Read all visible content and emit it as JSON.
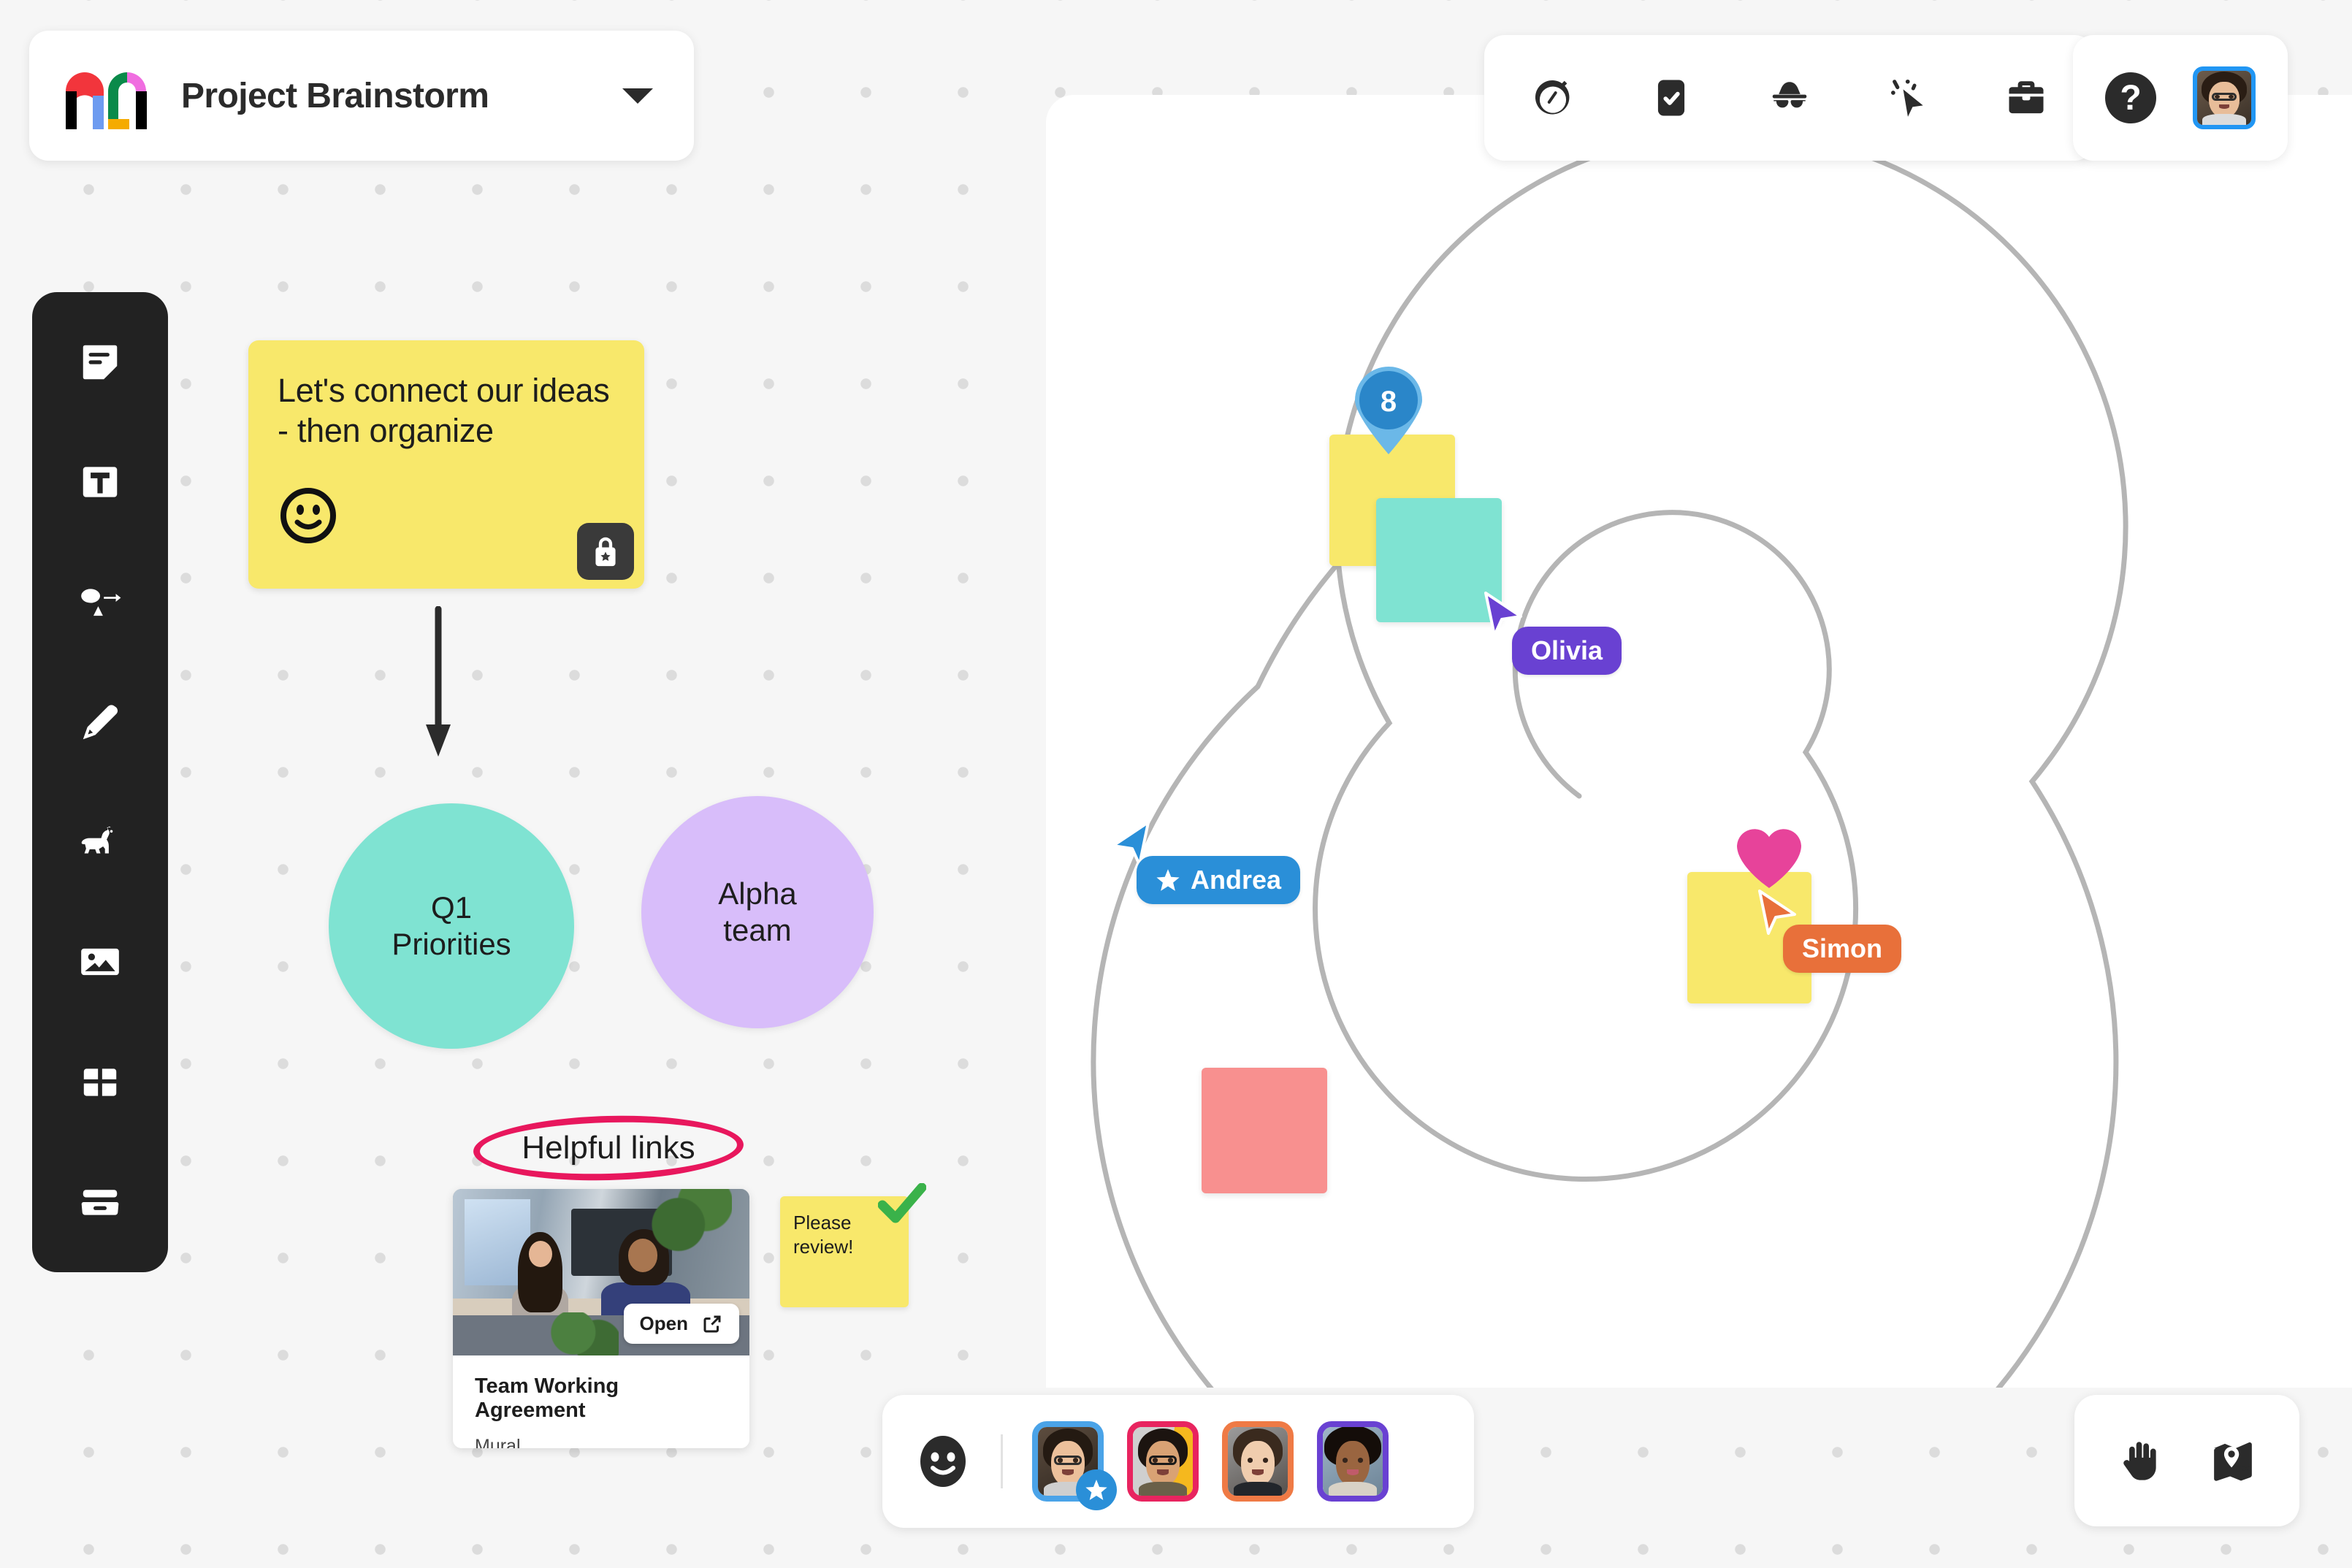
{
  "app": {
    "name": "Mural",
    "logo_icon": "mural-logo-icon"
  },
  "header": {
    "title": "Project Brainstorm",
    "dropdown_icon": "chevron-down-icon"
  },
  "left_toolbar": {
    "items": [
      {
        "icon": "sticky-note-icon",
        "label": "Sticky note"
      },
      {
        "icon": "text-icon",
        "label": "Text"
      },
      {
        "icon": "shapes-connector-icon",
        "label": "Shapes and connectors"
      },
      {
        "icon": "pen-icon",
        "label": "Drawing"
      },
      {
        "icon": "llama-icon",
        "label": "Mural llama"
      },
      {
        "icon": "image-icon",
        "label": "Image"
      },
      {
        "icon": "framework-grid-icon",
        "label": "Frameworks"
      },
      {
        "icon": "drawer-icon",
        "label": "Outline"
      }
    ]
  },
  "facilitation_toolbar": {
    "items": [
      {
        "icon": "timer-icon",
        "label": "Timer"
      },
      {
        "icon": "voting-checkbox-icon",
        "label": "Voting session"
      },
      {
        "icon": "private-mode-icon",
        "label": "Private mode"
      },
      {
        "icon": "summon-cursor-icon",
        "label": "Summon"
      },
      {
        "icon": "toolkit-icon",
        "label": "Facilitation toolkit"
      }
    ]
  },
  "help_bar": {
    "help_label": "?",
    "help_icon": "question-mark-icon",
    "avatar_icon": "current-user-avatar",
    "avatar_border_color": "#2196f3"
  },
  "canvas_left": {
    "sticky_main": {
      "text": "Let's connect our ideas - then organize",
      "emoji": "smiley-face-emoji",
      "color": "#f8e86b",
      "lock_badge_icon": "lock-star-icon"
    },
    "connector_icon": "down-arrow-connector",
    "shapes": [
      {
        "label": "Q1\nPriorities",
        "line1": "Q1",
        "line2": "Priorities",
        "color": "#7fe3d2"
      },
      {
        "label": "Alpha\nteam",
        "line1": "Alpha",
        "line2": "team",
        "color": "#d8bdfa"
      }
    ],
    "annotation": {
      "text": "Helpful links",
      "ink_color": "#e8175d",
      "shape": "ellipse"
    },
    "link_card": {
      "title": "Team Working Agreement",
      "source": "Mural",
      "open_label": "Open",
      "open_icon": "external-link-icon",
      "thumbnail_icon": "office-photo-thumbnail"
    },
    "sticky_review": {
      "text": "Please review!",
      "color": "#f8e86b",
      "check_icon": "green-check-icon",
      "check_color": "#3ab24a"
    }
  },
  "canvas_right": {
    "spiral_icon": "spiral-shape",
    "spiral_color": "#b5b5b5",
    "stickies": [
      {
        "name": "sticky-yellow-voted",
        "color": "#f8e86b"
      },
      {
        "name": "sticky-teal",
        "color": "#7fe3d2"
      },
      {
        "name": "sticky-yellow-hearted",
        "color": "#f8e86b"
      },
      {
        "name": "sticky-salmon",
        "color": "#f8908f"
      }
    ],
    "vote_pin": {
      "count": "8",
      "color": "#2a86c9",
      "icon": "vote-pin-icon"
    },
    "heart_reaction": {
      "icon": "heart-icon",
      "color": "#e7439a"
    },
    "cursors": [
      {
        "name": "Olivia",
        "color": "#6941d2",
        "icon": "cursor-arrow-icon",
        "badge": null
      },
      {
        "name": "Andrea",
        "color": "#2a8fd8",
        "icon": "cursor-arrow-icon",
        "badge": "star-facilitator-icon"
      },
      {
        "name": "Simon",
        "color": "#e8703a",
        "icon": "cursor-arrow-icon",
        "badge": null
      }
    ]
  },
  "people_bar": {
    "reactions_icon": "smiley-reactions-icon",
    "avatars": [
      {
        "name": "avatar-1",
        "border_color": "#4aa3e8",
        "badge": "star-facilitator-icon"
      },
      {
        "name": "avatar-2",
        "border_color": "#e8245f",
        "badge": null
      },
      {
        "name": "avatar-3",
        "border_color": "#ef7a45",
        "badge": null
      },
      {
        "name": "avatar-4",
        "border_color": "#6941d2",
        "badge": null
      }
    ]
  },
  "nav_bar": {
    "items": [
      {
        "icon": "hand-pan-icon",
        "label": "Pan"
      },
      {
        "icon": "map-minimap-icon",
        "label": "Minimap"
      }
    ]
  }
}
